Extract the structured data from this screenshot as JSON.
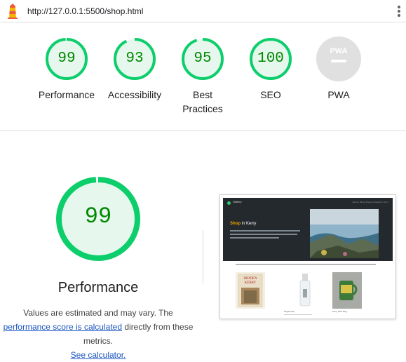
{
  "topbar": {
    "url": "http://127.0.0.1:5500/shop.html",
    "logo_icon": "lighthouse-icon",
    "menu_icon": "kebab-menu-icon"
  },
  "colors": {
    "pass_green": "#0cce6b",
    "pass_fill": "#e6f8ee",
    "pass_text": "#008800",
    "na_gray": "#e0e0e0",
    "link_blue": "#1a55c0"
  },
  "gauges": [
    {
      "score": 99,
      "label": "Performance"
    },
    {
      "score": 93,
      "label": "Accessibility"
    },
    {
      "score": 95,
      "label": "Best Practices"
    },
    {
      "score": 100,
      "label": "SEO"
    },
    {
      "score": null,
      "label": "PWA",
      "badge": "PWA"
    }
  ],
  "main": {
    "score": "99",
    "score_value": 99,
    "title": "Performance",
    "desc_prefix": "Values are estimated and may vary. The ",
    "desc_link1": "performance score is calculated",
    "desc_middle": " directly from these metrics. ",
    "desc_link2": "See calculator."
  },
  "thumbnail": {
    "brand": "Gallery",
    "nav": "Home   Shop   Events   Gallery   Cart",
    "heading_accent": "Shop",
    "heading_rest": " in Kerry",
    "products": [
      "Hidden Kerry",
      "Single Irish",
      "Kerry Glitz Mug"
    ],
    "book_title_1": "HIDDEN",
    "book_title_2": "KERRY"
  }
}
